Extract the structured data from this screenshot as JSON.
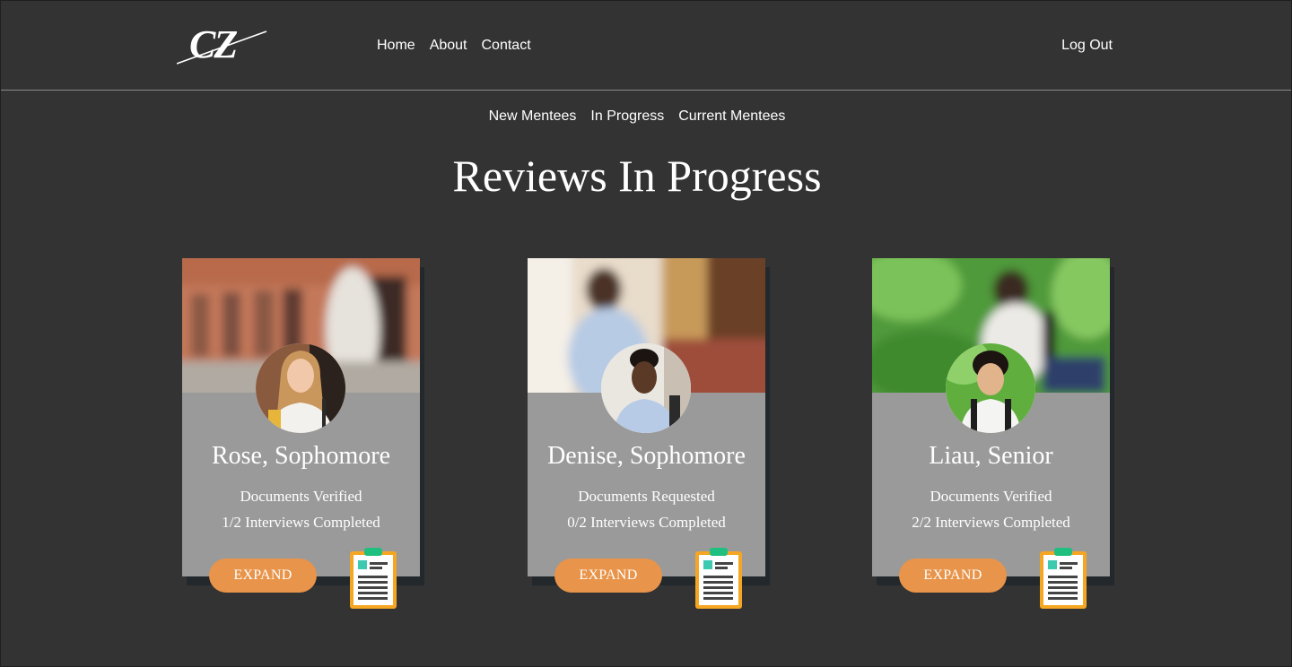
{
  "brand": {
    "logo_text": "CZ"
  },
  "nav": {
    "links": [
      {
        "label": "Home"
      },
      {
        "label": "About"
      },
      {
        "label": "Contact"
      }
    ],
    "logout_label": "Log Out"
  },
  "subnav": {
    "links": [
      {
        "label": "New Mentees"
      },
      {
        "label": "In Progress"
      },
      {
        "label": "Current Mentees"
      }
    ]
  },
  "page": {
    "title": "Reviews In Progress"
  },
  "cards": [
    {
      "name": "Rose, Sophomore",
      "status_line": "Documents Verified",
      "interview_line": "1/2 Interviews Completed",
      "button_label": "EXPAND"
    },
    {
      "name": "Denise, Sophomore",
      "status_line": "Documents Requested",
      "interview_line": "0/2 Interviews Completed",
      "button_label": "EXPAND"
    },
    {
      "name": "Liau, Senior",
      "status_line": "Documents Verified",
      "interview_line": "2/2 Interviews Completed",
      "button_label": "EXPAND"
    }
  ],
  "colors": {
    "background": "#333333",
    "card": "#9a9a9a",
    "card_shadow": "#23282d",
    "button": "#e8944a",
    "clipboard_border": "#f5a623",
    "clipboard_clip": "#1fbf7f"
  },
  "icons": {
    "card_action": "clipboard-icon"
  }
}
